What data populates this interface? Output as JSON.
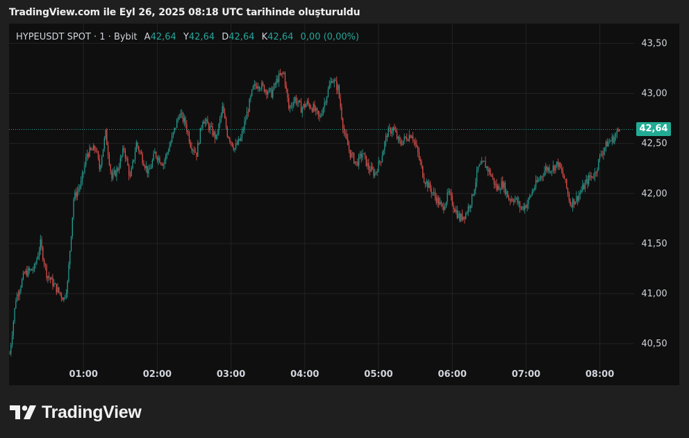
{
  "caption": "TradingView.com ile Eyl 26, 2025 08:18 UTC tarihinde oluşturuldu",
  "legend": {
    "symbol": "HYPEUSDT SPOT · 1 · Bybit",
    "open_key": "A",
    "open": "42,64",
    "high_key": "Y",
    "high": "42,64",
    "low_key": "D",
    "low": "42,64",
    "close_key": "K",
    "close": "42,64",
    "change": "0,00 (0,00%)"
  },
  "last_price_label": "42,64",
  "brand": "TradingView",
  "colors": {
    "up": "#26a69a",
    "down": "#ef5350",
    "price_tag": "#22ab94",
    "background": "#0f0f0f"
  },
  "chart_data": {
    "type": "candlestick",
    "xticks": [
      "01:00",
      "02:00",
      "03:00",
      "04:00",
      "05:00",
      "06:00",
      "07:00",
      "08:00"
    ],
    "yticks": [
      "43,50",
      "43,00",
      "42,50",
      "42,00",
      "41,50",
      "41,00",
      "40,50"
    ],
    "ylim": [
      40.3,
      43.6
    ],
    "last_price": 42.64,
    "close_path": [
      [
        "00:00",
        40.4
      ],
      [
        "00:05",
        40.95
      ],
      [
        "00:12",
        41.2
      ],
      [
        "00:20",
        41.25
      ],
      [
        "00:25",
        41.5
      ],
      [
        "00:30",
        41.2
      ],
      [
        "00:38",
        41.05
      ],
      [
        "00:44",
        40.95
      ],
      [
        "00:47",
        41.1
      ],
      [
        "00:52",
        41.95
      ],
      [
        "00:58",
        42.1
      ],
      [
        "01:03",
        42.4
      ],
      [
        "01:10",
        42.45
      ],
      [
        "01:13",
        42.25
      ],
      [
        "01:18",
        42.6
      ],
      [
        "01:23",
        42.15
      ],
      [
        "01:28",
        42.25
      ],
      [
        "01:33",
        42.45
      ],
      [
        "01:38",
        42.15
      ],
      [
        "01:43",
        42.5
      ],
      [
        "01:48",
        42.35
      ],
      [
        "01:53",
        42.2
      ],
      [
        "01:58",
        42.4
      ],
      [
        "02:05",
        42.3
      ],
      [
        "02:12",
        42.55
      ],
      [
        "02:18",
        42.8
      ],
      [
        "02:23",
        42.7
      ],
      [
        "02:27",
        42.5
      ],
      [
        "02:32",
        42.4
      ],
      [
        "02:37",
        42.75
      ],
      [
        "02:43",
        42.65
      ],
      [
        "02:48",
        42.55
      ],
      [
        "02:53",
        42.85
      ],
      [
        "02:57",
        42.6
      ],
      [
        "03:03",
        42.45
      ],
      [
        "03:08",
        42.55
      ],
      [
        "03:13",
        42.8
      ],
      [
        "03:18",
        43.05
      ],
      [
        "03:22",
        43.1
      ],
      [
        "03:27",
        43.05
      ],
      [
        "03:33",
        43.0
      ],
      [
        "03:38",
        43.15
      ],
      [
        "03:43",
        43.2
      ],
      [
        "03:47",
        42.85
      ],
      [
        "03:52",
        42.95
      ],
      [
        "03:57",
        42.85
      ],
      [
        "04:02",
        42.9
      ],
      [
        "04:07",
        42.85
      ],
      [
        "04:12",
        42.75
      ],
      [
        "04:17",
        42.95
      ],
      [
        "04:22",
        43.15
      ],
      [
        "04:27",
        43.05
      ],
      [
        "04:32",
        42.6
      ],
      [
        "04:37",
        42.4
      ],
      [
        "04:42",
        42.3
      ],
      [
        "04:47",
        42.4
      ],
      [
        "04:52",
        42.25
      ],
      [
        "04:57",
        42.2
      ],
      [
        "05:02",
        42.35
      ],
      [
        "05:07",
        42.6
      ],
      [
        "05:12",
        42.65
      ],
      [
        "05:17",
        42.5
      ],
      [
        "05:22",
        42.55
      ],
      [
        "05:27",
        42.6
      ],
      [
        "05:32",
        42.4
      ],
      [
        "05:37",
        42.15
      ],
      [
        "05:42",
        42.05
      ],
      [
        "05:47",
        41.95
      ],
      [
        "05:52",
        41.85
      ],
      [
        "05:57",
        42.0
      ],
      [
        "06:02",
        41.85
      ],
      [
        "06:06",
        41.75
      ],
      [
        "06:11",
        41.8
      ],
      [
        "06:16",
        41.95
      ],
      [
        "06:21",
        42.25
      ],
      [
        "06:26",
        42.3
      ],
      [
        "06:31",
        42.2
      ],
      [
        "06:36",
        42.05
      ],
      [
        "06:41",
        42.1
      ],
      [
        "06:46",
        41.95
      ],
      [
        "06:51",
        41.95
      ],
      [
        "06:56",
        41.85
      ],
      [
        "07:01",
        41.9
      ],
      [
        "07:06",
        42.05
      ],
      [
        "07:11",
        42.15
      ],
      [
        "07:16",
        42.25
      ],
      [
        "07:21",
        42.25
      ],
      [
        "07:26",
        42.3
      ],
      [
        "07:31",
        42.15
      ],
      [
        "07:36",
        41.9
      ],
      [
        "07:41",
        41.95
      ],
      [
        "07:46",
        42.05
      ],
      [
        "07:51",
        42.15
      ],
      [
        "07:56",
        42.2
      ],
      [
        "08:01",
        42.4
      ],
      [
        "08:06",
        42.5
      ],
      [
        "08:11",
        42.55
      ],
      [
        "08:16",
        42.64
      ]
    ]
  }
}
